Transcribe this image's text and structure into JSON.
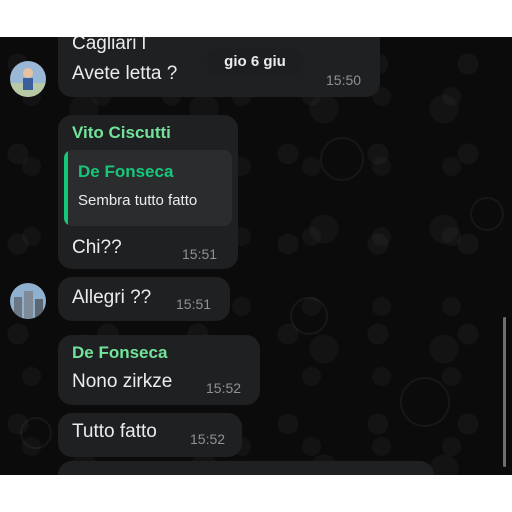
{
  "colors": {
    "background": "#0b0b0b",
    "bubble": "#1f2022",
    "text": "#e9edef",
    "time": "#8d9296",
    "sender_green": "#72e39a",
    "quote_bar": "#18c67a",
    "quote_bg": "#2a2c2e"
  },
  "date_pill": {
    "label": "gio 6 giu"
  },
  "messages": [
    {
      "lines": [
        "Cagliari l",
        "Avete letta ?"
      ],
      "time": "15:50",
      "avatar": "person-photo-icon"
    },
    {
      "sender": "Vito  Ciscutti",
      "quote": {
        "author": "De Fonseca",
        "text": "Sembra tutto fatto"
      },
      "text": "Chi??",
      "time": "15:51"
    },
    {
      "text": "Allegri ??",
      "time": "15:51",
      "avatar": "building-photo-icon"
    },
    {
      "sender": "De Fonseca",
      "text": "Nono zirkze",
      "time": "15:52"
    },
    {
      "text": "Tutto fatto",
      "time": "15:52"
    }
  ]
}
